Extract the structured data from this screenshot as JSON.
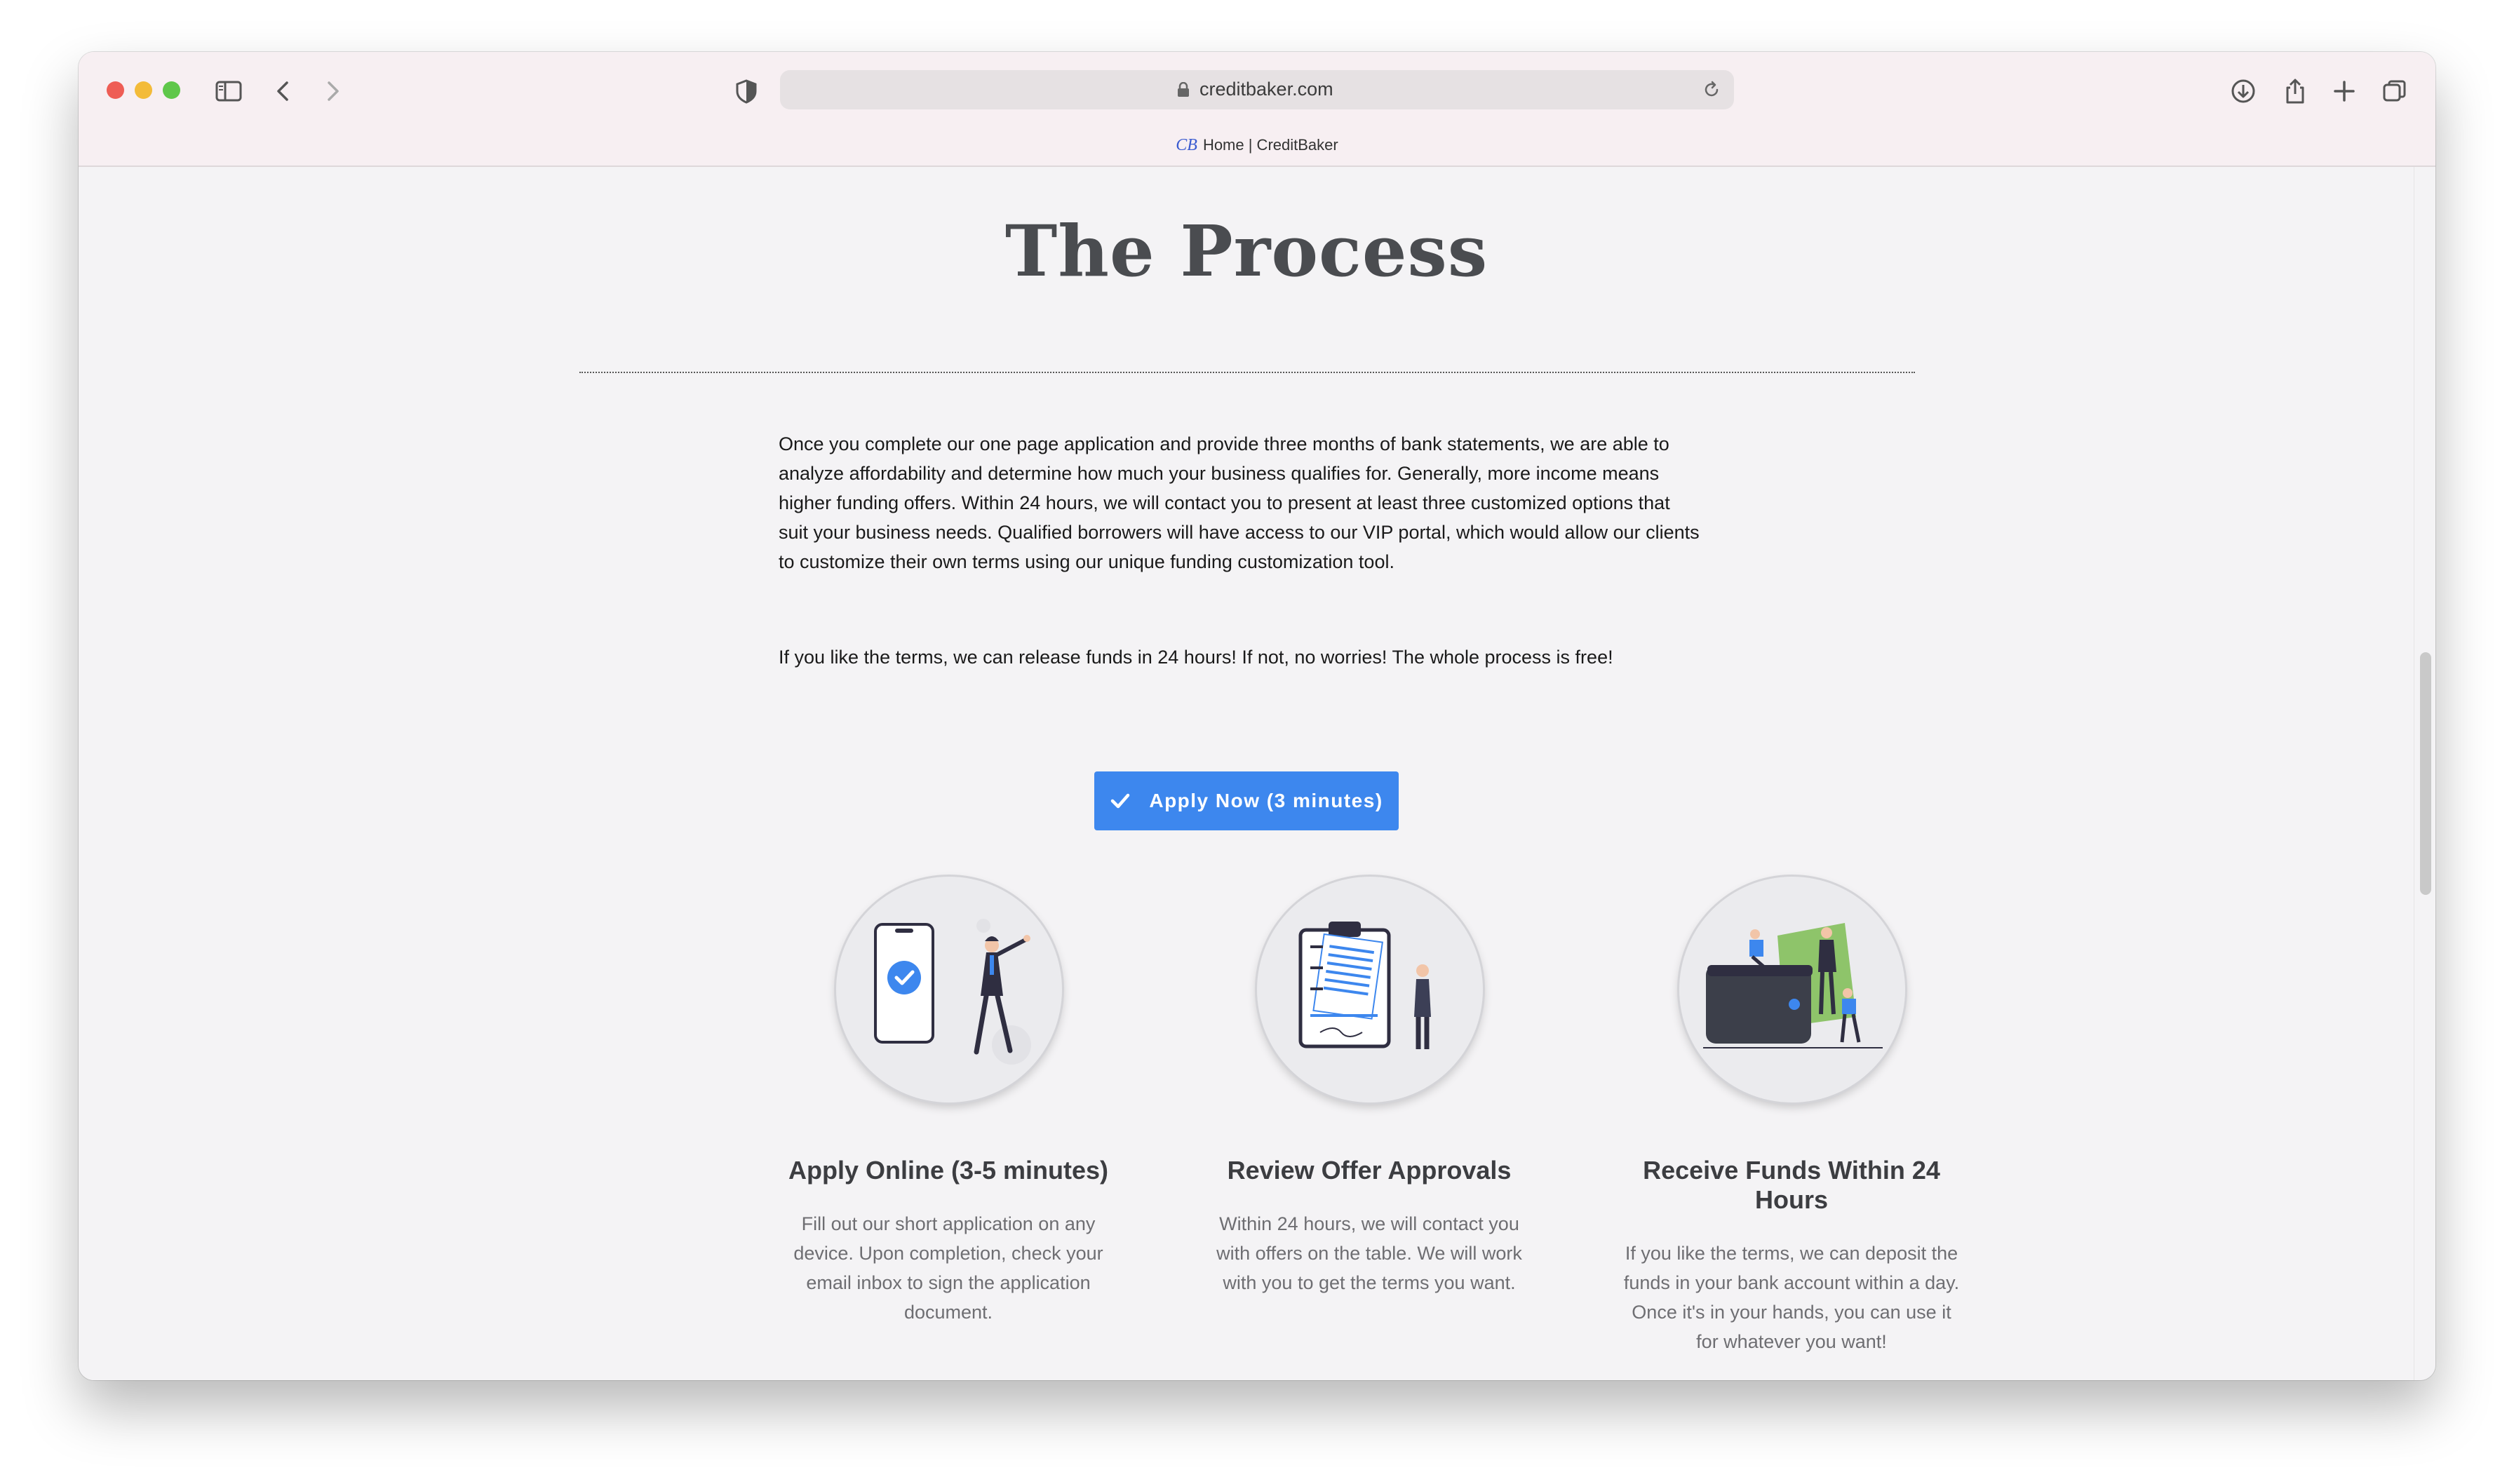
{
  "browser": {
    "url": "creditbaker.com",
    "tab_favicon": "CB",
    "tab_title": "Home | CreditBaker"
  },
  "page": {
    "heading": "The Process",
    "paragraph1": "Once you complete our one page application and provide three months of bank statements, we are able to analyze affordability and determine how much your business qualifies for.  Generally, more income means higher funding offers.  Within 24 hours, we will contact you to present at least three customized options that suit your business needs.  Qualified borrowers will have access to our VIP portal, which would allow our clients to customize their own terms using our unique funding customization tool.",
    "paragraph2": "If you like the terms, we can release funds in 24 hours!  If not, no worries!  The whole process is free!",
    "cta_label": "Apply Now (3 minutes)",
    "features": [
      {
        "title": "Apply Online (3-5 minutes)",
        "description": "Fill out our short application on any device. Upon completion, check your email inbox to sign the application document."
      },
      {
        "title": "Review Offer Approvals",
        "description": "Within 24 hours, we will contact you with offers on the table. We will work with you to get the terms you want."
      },
      {
        "title": "Receive Funds Within 24 Hours",
        "description": "If you like the terms, we can deposit the funds in your bank account within a day. Once it's in your hands, you can use it for whatever you want!"
      }
    ]
  },
  "colors": {
    "accent": "#3d87ee",
    "heading": "#4a4c50",
    "body_text": "#1a1a1a",
    "muted_text": "#6e6e72",
    "money_green": "#8ec46a"
  },
  "icons": [
    "sidebar-icon",
    "back-chevron-icon",
    "forward-chevron-icon",
    "shield-icon",
    "lock-icon",
    "reload-icon",
    "download-icon",
    "share-icon",
    "new-tab-icon",
    "tabs-overview-icon",
    "checkmark-icon"
  ]
}
